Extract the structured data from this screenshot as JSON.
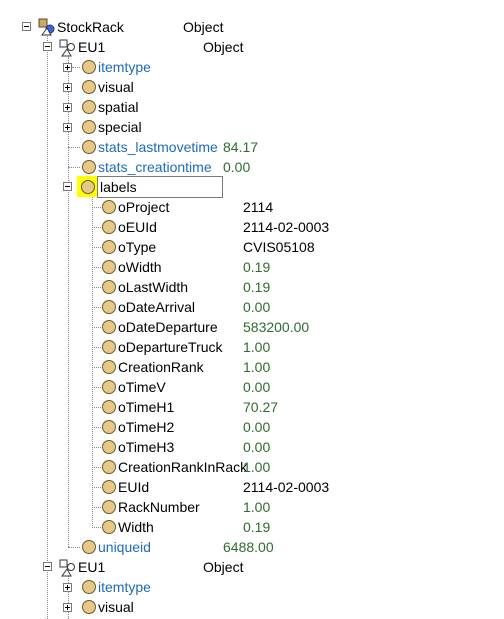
{
  "tree": {
    "root": {
      "label": "StockRack",
      "type": "Object"
    },
    "eu1_first": {
      "label": "EU1",
      "type": "Object"
    },
    "groups": [
      "itemtype",
      "visual",
      "spatial",
      "special"
    ],
    "stats": [
      {
        "label": "stats_lastmovetime",
        "value": "84.17"
      },
      {
        "label": "stats_creationtime",
        "value": "0.00"
      }
    ],
    "labels_node": {
      "label": "labels"
    },
    "label_items": [
      {
        "name": "oProject",
        "value": "2114"
      },
      {
        "name": "oEUId",
        "value": "2114-02-0003"
      },
      {
        "name": "oType",
        "value": "CVIS05108"
      },
      {
        "name": "oWidth",
        "value": "0.19"
      },
      {
        "name": "oLastWidth",
        "value": "0.19"
      },
      {
        "name": "oDateArrival",
        "value": "0.00"
      },
      {
        "name": "oDateDeparture",
        "value": "583200.00"
      },
      {
        "name": "oDepartureTruck",
        "value": "1.00"
      },
      {
        "name": "CreationRank",
        "value": "1.00"
      },
      {
        "name": "oTimeV",
        "value": "0.00"
      },
      {
        "name": "oTimeH1",
        "value": "70.27"
      },
      {
        "name": "oTimeH2",
        "value": "0.00"
      },
      {
        "name": "oTimeH3",
        "value": "0.00"
      },
      {
        "name": "CreationRankInRack",
        "value": "1.00"
      },
      {
        "name": "EUId",
        "value": "2114-02-0003"
      },
      {
        "name": "RackNumber",
        "value": "1.00"
      },
      {
        "name": "Width",
        "value": "0.19"
      }
    ],
    "uniqueid": {
      "label": "uniqueid",
      "value": "6488.00"
    },
    "eu1_second": {
      "label": "EU1",
      "type": "Object"
    },
    "groups_second": [
      "itemtype",
      "visual"
    ]
  },
  "colors": {
    "link_blue": "#1e6bb8",
    "value_green": "#2f6b2f",
    "node_fill": "#e6c98a",
    "highlight": "#ffff00"
  },
  "icons": {
    "expander": "plus-minus-box",
    "node": "circle-node-icon",
    "object": "object-shape-icon"
  }
}
